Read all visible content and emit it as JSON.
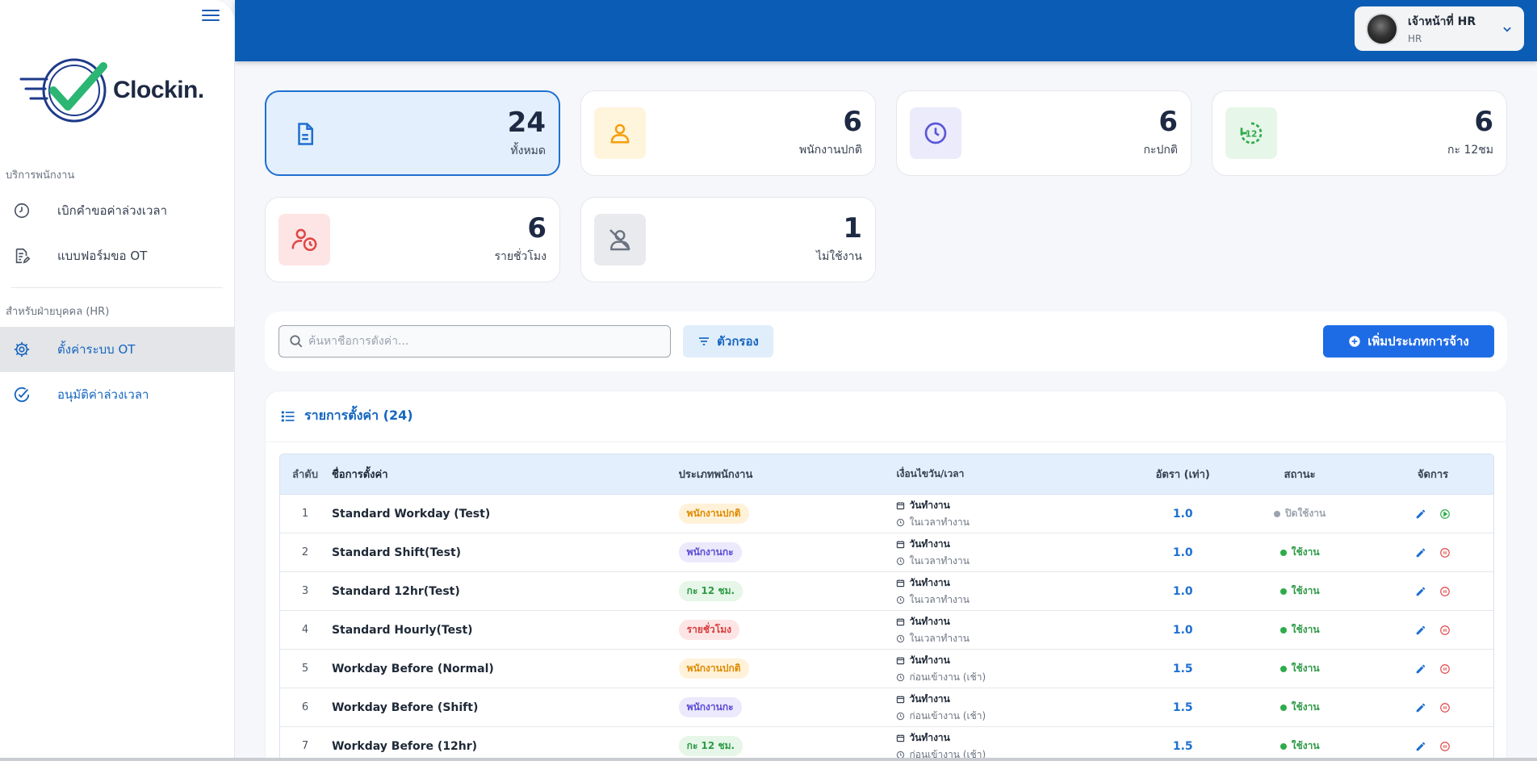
{
  "app": {
    "logo_text": "Clockin."
  },
  "sidebar": {
    "section1_title": "บริการพนักงาน",
    "section2_title": "สำหรับฝ่ายบุคคล (HR)",
    "items": [
      {
        "label": "เบิกคำขอค่าล่วงเวลา",
        "icon": "clock-icon"
      },
      {
        "label": "แบบฟอร์มขอ OT",
        "icon": "form-edit-icon"
      },
      {
        "label": "ตั้งค่าระบบ OT",
        "icon": "gear-icon"
      },
      {
        "label": "อนุมัติค่าล่วงเวลา",
        "icon": "check-circle-icon"
      }
    ]
  },
  "user": {
    "name": "เจ้าหน้าที่ HR",
    "role": "HR"
  },
  "stats": [
    {
      "value": "24",
      "label": "ทั้งหมด",
      "icon": "document-icon",
      "color": "#1e6fd0",
      "bg": "#e3effc"
    },
    {
      "value": "6",
      "label": "พนักงานปกติ",
      "icon": "person-icon",
      "color": "#f59e0b",
      "bg": "#fff4dc"
    },
    {
      "value": "6",
      "label": "กะปกติ",
      "icon": "clock-icon",
      "color": "#5b57d6",
      "bg": "#ecebfb"
    },
    {
      "value": "6",
      "label": "กะ 12ชม",
      "icon": "twelve-hour-icon",
      "color": "#2eab4a",
      "bg": "#e6f6e8"
    },
    {
      "value": "6",
      "label": "รายชั่วโมง",
      "icon": "person-clock-icon",
      "color": "#e04646",
      "bg": "#fde5e5"
    },
    {
      "value": "1",
      "label": "ไม่ใช้งาน",
      "icon": "person-off-icon",
      "color": "#6b7280",
      "bg": "#e8eaed"
    }
  ],
  "toolbar": {
    "search_placeholder": "ค้นหาชื่อการตั้งค่า...",
    "filter_label": "ตัวกรอง",
    "add_label": "เพิ่มประเภทการจ้าง"
  },
  "list": {
    "title": "รายการตั้งค่า (24)",
    "columns": {
      "idx": "ลำดับ",
      "name": "ชื่อการตั้งค่า",
      "type": "ประเภทพนักงาน",
      "cond": "เงื่อนไขวัน/เวลา",
      "rate": "อัตรา (เท่า)",
      "status": "สถานะ",
      "action": "จัดการ"
    },
    "rows": [
      {
        "idx": "1",
        "name": "Standard Workday (Test)",
        "type": "พนักงานปกติ",
        "type_class": "b-normal",
        "day": "วันทำงาน",
        "time": "ในเวลาทำงาน",
        "rate": "1.0",
        "status": "ปิดใช้งาน",
        "active": false
      },
      {
        "idx": "2",
        "name": "Standard Shift(Test)",
        "type": "พนักงานกะ",
        "type_class": "b-shift",
        "day": "วันทำงาน",
        "time": "ในเวลาทำงาน",
        "rate": "1.0",
        "status": "ใช้งาน",
        "active": true
      },
      {
        "idx": "3",
        "name": "Standard 12hr(Test)",
        "type": "กะ 12 ชม.",
        "type_class": "b-12",
        "day": "วันทำงาน",
        "time": "ในเวลาทำงาน",
        "rate": "1.0",
        "status": "ใช้งาน",
        "active": true
      },
      {
        "idx": "4",
        "name": "Standard Hourly(Test)",
        "type": "รายชั่วโมง",
        "type_class": "b-hourly",
        "day": "วันทำงาน",
        "time": "ในเวลาทำงาน",
        "rate": "1.0",
        "status": "ใช้งาน",
        "active": true
      },
      {
        "idx": "5",
        "name": "Workday Before (Normal)",
        "type": "พนักงานปกติ",
        "type_class": "b-normal",
        "day": "วันทำงาน",
        "time": "ก่อนเข้างาน (เช้า)",
        "rate": "1.5",
        "status": "ใช้งาน",
        "active": true
      },
      {
        "idx": "6",
        "name": "Workday Before (Shift)",
        "type": "พนักงานกะ",
        "type_class": "b-shift",
        "day": "วันทำงาน",
        "time": "ก่อนเข้างาน (เช้า)",
        "rate": "1.5",
        "status": "ใช้งาน",
        "active": true
      },
      {
        "idx": "7",
        "name": "Workday Before (12hr)",
        "type": "กะ 12 ชม.",
        "type_class": "b-12",
        "day": "วันทำงาน",
        "time": "ก่อนเข้างาน (เช้า)",
        "rate": "1.5",
        "status": "ใช้งาน",
        "active": true
      }
    ]
  }
}
